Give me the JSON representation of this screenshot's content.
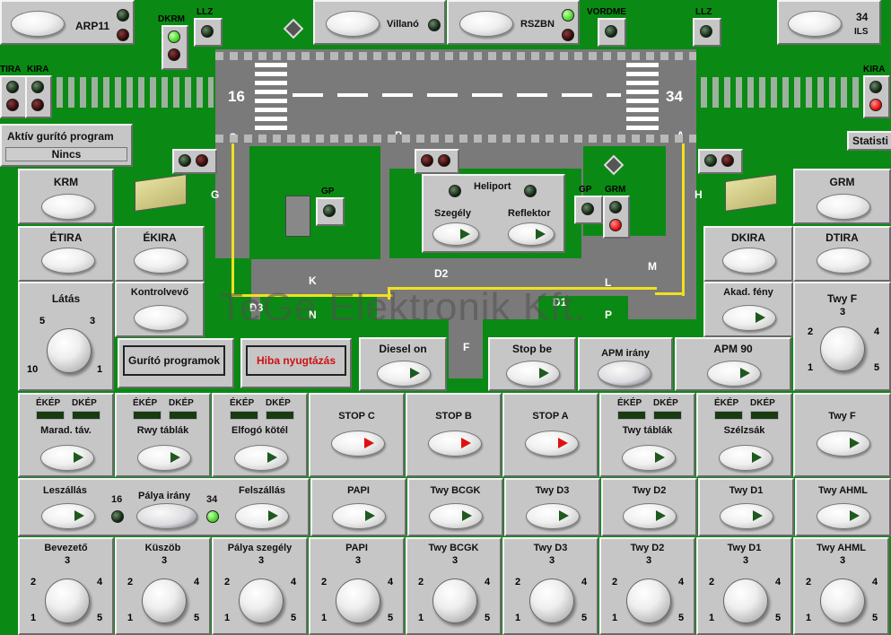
{
  "top": {
    "arp": "ARP11",
    "dkrm": "DKRM",
    "llz1": "LLZ",
    "villano": "Villanó",
    "rszbn": "RSZBN",
    "vordme": "VORDME",
    "llz2": "LLZ",
    "ils_num": "34",
    "ils": "ILS"
  },
  "left": {
    "tira": "TIRA",
    "kira": "KIRA",
    "program_title": "Aktív gurító program",
    "program_value": "Nincs"
  },
  "right": {
    "kira": "KIRA",
    "statisti": "Statisti"
  },
  "map": {
    "rwy_left": "16",
    "rwy_right": "34",
    "tw_c": "C",
    "tw_b": "B",
    "tw_a": "A",
    "tw_g": "G",
    "tw_h": "H",
    "tw_m": "M",
    "tw_d2": "D2",
    "tw_d3": "D3",
    "tw_d1": "D1",
    "tw_k": "K",
    "tw_n": "N",
    "tw_l": "L",
    "tw_p": "P",
    "tw_f": "F",
    "gp1": "GP",
    "gp2": "GP",
    "grm": "GRM",
    "heliport": "Heliport",
    "szegely": "Szegély",
    "reflektor": "Reflektor"
  },
  "watermark": "TeGe Elektronik Kft.",
  "panels": {
    "krm": "KRM",
    "etira": "ÉTIRA",
    "ekira": "ÉKIRA",
    "latas": "Látás",
    "kontrolveve": "Kontrolvevő",
    "gurito": "Gurító programok",
    "hiba": "Hiba nyugtázás",
    "diesel": "Diesel on",
    "stopbe": "Stop be",
    "apm_irany": "APM irány",
    "apm90": "APM 90",
    "grm": "GRM",
    "dkira": "DKIRA",
    "dtira": "DTIRA",
    "akad": "Akad. fény",
    "twyf_knob": "Twy F"
  },
  "row3": [
    {
      "label": "Marad. táv.",
      "eke": "ÉKÉP",
      "dke": "DKÉP"
    },
    {
      "label": "Rwy táblák",
      "eke": "ÉKÉP",
      "dke": "DKÉP"
    },
    {
      "label": "Elfogó kötél",
      "eke": "ÉKÉP",
      "dke": "DKÉP"
    },
    {
      "label": "STOP C"
    },
    {
      "label": "STOP B"
    },
    {
      "label": "STOP A"
    },
    {
      "label": "Twy táblák",
      "eke": "ÉKÉP",
      "dke": "DKÉP"
    },
    {
      "label": "Szélzsák",
      "eke": "ÉKÉP",
      "dke": "DKÉP"
    },
    {
      "label": "Twy F"
    }
  ],
  "row4": {
    "leszallas": "Leszállás",
    "palya_irany": "Pálya irány",
    "n16": "16",
    "n34": "34",
    "felszallas": "Felszállás",
    "items": [
      "PAPI",
      "Twy BCGK",
      "Twy D3",
      "Twy D2",
      "Twy D1",
      "Twy AHML"
    ]
  },
  "knobs": {
    "labels": [
      "Bevezető",
      "Küszöb",
      "Pálya szegély",
      "PAPI",
      "Twy BCGK",
      "Twy D3",
      "Twy D2",
      "Twy D1",
      "Twy AHML"
    ],
    "n1": "1",
    "n2": "2",
    "n3": "3",
    "n4": "4",
    "n5": "5"
  },
  "latas_nums": {
    "n5": "5",
    "n3": "3",
    "n10": "10",
    "n1": "1"
  },
  "twyf_nums": {
    "n3": "3",
    "n2": "2",
    "n4": "4",
    "n1": "1",
    "n5": "5"
  }
}
